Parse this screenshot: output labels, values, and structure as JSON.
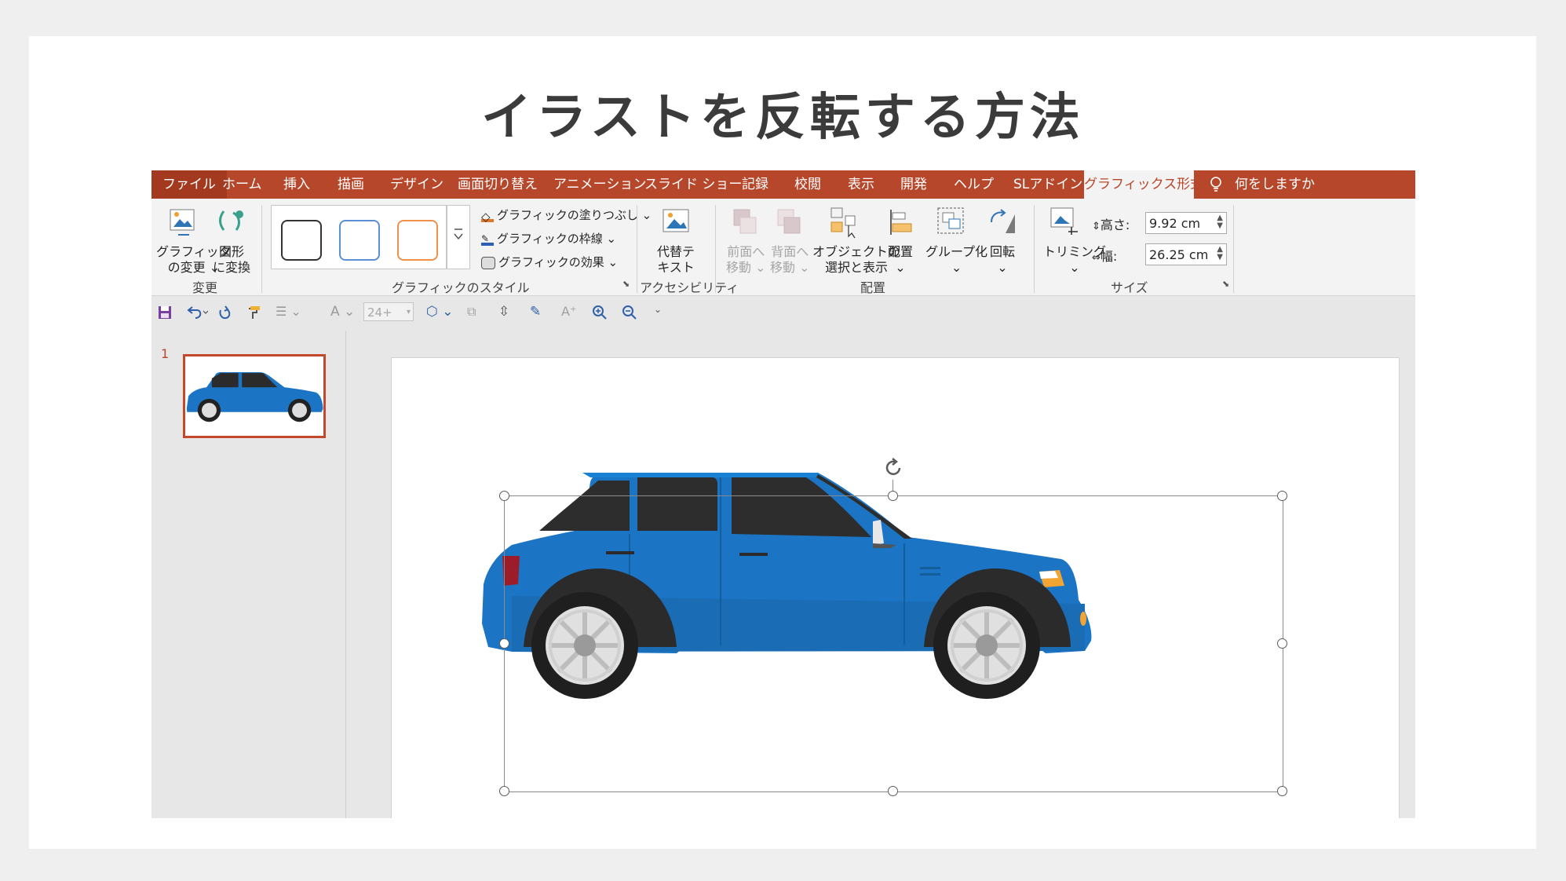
{
  "heading": "イラストを反転する方法",
  "tabs": {
    "file": "ファイル",
    "items": [
      "ホーム",
      "挿入",
      "描画",
      "デザイン",
      "画面切り替え",
      "アニメーション",
      "スライド ショー",
      "記録",
      "校閲",
      "表示",
      "開発",
      "ヘルプ",
      "SLアドイン"
    ],
    "active": "グラフィックス形式",
    "tell_me": "何をしますか"
  },
  "ribbon": {
    "change_graphic": [
      "グラフィック",
      "の変更 ⌄"
    ],
    "convert_shape": [
      "図形",
      "に変換"
    ],
    "group_change": "変更",
    "fill": "グラフィックの塗りつぶし ⌄",
    "outline": "グラフィックの枠線 ⌄",
    "effects": "グラフィックの効果 ⌄",
    "group_styles": "グラフィックのスタイル",
    "alt_text": [
      "代替テ",
      "キスト"
    ],
    "group_access": "アクセシビリティ",
    "bring_forward": [
      "前面へ",
      "移動 ⌄"
    ],
    "send_backward": [
      "背面へ",
      "移動 ⌄"
    ],
    "selection_pane": [
      "オブジェクトの",
      "選択と表示"
    ],
    "align": [
      "配置",
      "⌄"
    ],
    "group": [
      "グループ化",
      "⌄"
    ],
    "rotate": [
      "回転",
      "⌄"
    ],
    "group_arrange": "配置",
    "crop": [
      "トリミング",
      "⌄"
    ],
    "height_label": "高さ:",
    "height_value": "9.92 cm",
    "width_label": "幅:",
    "width_value": "26.25 cm",
    "group_size": "サイズ"
  },
  "qat": {
    "font_size": "24+"
  },
  "slides": {
    "number": "1"
  },
  "colors": {
    "accent": "#b7472a",
    "car_body": "#1b74c4"
  },
  "icons": [
    "save-icon",
    "undo-icon",
    "redo-icon",
    "format-painter-icon",
    "bullets-icon",
    "font-color-icon",
    "rotate-handle-icon",
    "lightbulb-icon"
  ]
}
